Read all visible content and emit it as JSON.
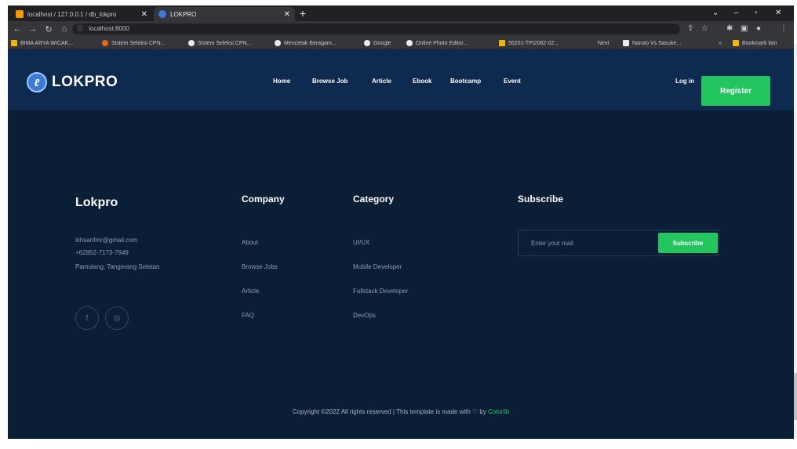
{
  "browser": {
    "tabs": [
      {
        "title": "localhost / 127.0.0.1 / db_lokpro",
        "favicon_color": "#f29900",
        "active": false
      },
      {
        "title": "LOKPRO",
        "favicon_color": "#3a7bd5",
        "active": true
      }
    ],
    "new_tab_label": "+",
    "address": "localhost:8000",
    "bookmarks": [
      {
        "label": "BIMA ARYA WICAK...",
        "icon_color": "#f2b705"
      },
      {
        "label": "Sistem Seleksi CPN...",
        "icon_color": "#e36b1a"
      },
      {
        "label": "Sistem Seleksi CPN...",
        "icon_color": "#e8eaed"
      },
      {
        "label": "Mencetak Beragam...",
        "icon_color": "#e8eaed"
      },
      {
        "label": "Google",
        "icon_color": "#e8eaed"
      },
      {
        "label": "Online Photo Editor...",
        "icon_color": "#e8eaed"
      },
      {
        "label": "55201-TPI2082-02...",
        "icon_color": "#f2b705"
      },
      {
        "label": "Next",
        "icon_color": ""
      },
      {
        "label": "Naruto Vs Sasuke...",
        "icon_color": "#e8eaed"
      },
      {
        "label": "Bookmark lain",
        "icon_color": "#f2b705"
      }
    ]
  },
  "site": {
    "brand": "LOKPRO",
    "menu": [
      "Home",
      "Browse Job",
      "Article",
      "Ebook",
      "Bootcamp",
      "Event"
    ],
    "login": "Log in",
    "register": "Register",
    "colors": {
      "header": "#0e2a4f",
      "body": "#0a1e35",
      "accent": "#22c55e"
    }
  },
  "footer": {
    "brand": "Lokpro",
    "contact": [
      "ikhsanfmr@gmail.com",
      "+62852-7173-7949",
      "Pamulang, Tangerang Selatan"
    ],
    "social_icons": [
      "facebook-icon",
      "instagram-icon"
    ],
    "company": {
      "title": "Company",
      "links": [
        "About",
        "Browse Jobs",
        "Article",
        "FAQ"
      ]
    },
    "category": {
      "title": "Category",
      "links": [
        "UI/UX",
        "Mobile Developer",
        "Fullstack Developer",
        "DevOps"
      ]
    },
    "subscribe": {
      "title": "Subscribe",
      "placeholder": "Enter your mail",
      "button": "Subscribe"
    },
    "copyright": {
      "text": "Copyright ©2022 All rights reserved | This template is made with ♡ by ",
      "link": "Colorlib"
    }
  }
}
